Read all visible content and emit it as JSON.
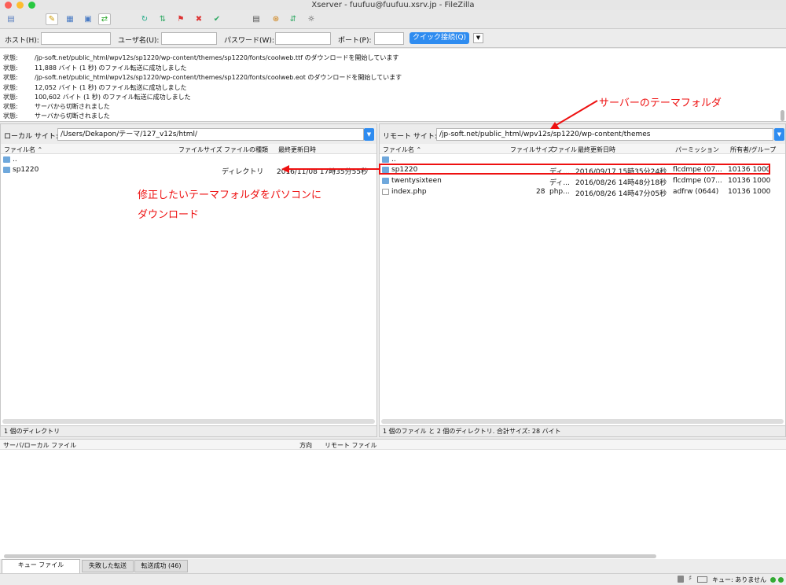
{
  "window": {
    "title": "Xserver - fuufuu@fuufuu.xsrv.jp - FileZilla"
  },
  "quickconnect": {
    "host_label": "ホスト(H):",
    "user_label": "ユーザ名(U):",
    "pass_label": "パスワード(W):",
    "port_label": "ポート(P):",
    "connect_label": "クイック接続(Q)",
    "host_value": "",
    "user_value": "",
    "pass_value": "",
    "port_value": ""
  },
  "log": [
    {
      "status": "状態:",
      "message": "/jp-soft.net/public_html/wpv12s/sp1220/wp-content/themes/sp1220/fonts/coolweb.ttf のダウンロードを開始しています"
    },
    {
      "status": "状態:",
      "message": "11,888 バイト (1 秒) のファイル転送に成功しました"
    },
    {
      "status": "状態:",
      "message": "/jp-soft.net/public_html/wpv12s/sp1220/wp-content/themes/sp1220/fonts/coolweb.eot のダウンロードを開始しています"
    },
    {
      "status": "状態:",
      "message": "12,052 バイト (1 秒) のファイル転送に成功しました"
    },
    {
      "status": "状態:",
      "message": "100,602 バイト (1 秒) のファイル転送に成功しました"
    },
    {
      "status": "状態:",
      "message": "サーバから切断されました"
    },
    {
      "status": "状態:",
      "message": "サーバから切断されました"
    }
  ],
  "local": {
    "site_label": "ローカル サイト:",
    "path": "/Users/Dekapon/テーマ/127_v12s/html/",
    "columns": {
      "name": "ファイル名",
      "size": "ファイルサイズ",
      "type": "ファイルの種類",
      "modified": "最終更新日時"
    },
    "rows": [
      {
        "name": "..",
        "size": "",
        "type": "",
        "modified": ""
      },
      {
        "name": "sp1220",
        "size": "",
        "type": "ディレクトリ",
        "modified": "2016/11/08 17時35分55秒"
      }
    ],
    "status": "1 個のディレクトリ"
  },
  "remote": {
    "site_label": "リモート サイト:",
    "path": "/jp-soft.net/public_html/wpv12s/sp1220/wp-content/themes",
    "columns": {
      "name": "ファイル名",
      "size": "ファイルサイズ",
      "type": "ファイル",
      "modified": "最終更新日時",
      "perm": "パーミッション",
      "owner": "所有者/グループ"
    },
    "rows": [
      {
        "name": "..",
        "size": "",
        "type": "",
        "modified": "",
        "perm": "",
        "owner": ""
      },
      {
        "name": "sp1220",
        "size": "",
        "type": "ディ...",
        "modified": "2016/09/17 15時35分24秒",
        "perm": "flcdmpe (07...",
        "owner": "10136 1000"
      },
      {
        "name": "twentysixteen",
        "size": "",
        "type": "ディ...",
        "modified": "2016/08/26 14時48分18秒",
        "perm": "flcdmpe (07...",
        "owner": "10136 1000"
      },
      {
        "name": "index.php",
        "size": "28",
        "type": "php...",
        "modified": "2016/08/26 14時47分05秒",
        "perm": "adfrw (0644)",
        "owner": "10136 1000"
      }
    ],
    "status": "1 個のファイル と 2 個のディレクトリ. 合計サイズ: 28 バイト"
  },
  "queue": {
    "col_server": "サーバ/ローカル ファイル",
    "col_direction": "方向",
    "col_remote": "リモート ファイル"
  },
  "tabs": [
    {
      "label": "キュー ファイル"
    },
    {
      "label": "失敗した転送"
    },
    {
      "label": "転送成功 (46)"
    }
  ],
  "statusbar": {
    "queue": "キュー: ありません"
  },
  "annotations": {
    "remote_folder": "サーバーのテーマフォルダ",
    "download_line1": "修正したいテーマフォルダをパソコンに",
    "download_line2": "ダウンロード"
  },
  "colors": {
    "annotation": "#e11111",
    "accent": "#2f8cf0",
    "folder": "#6fa8dc"
  }
}
